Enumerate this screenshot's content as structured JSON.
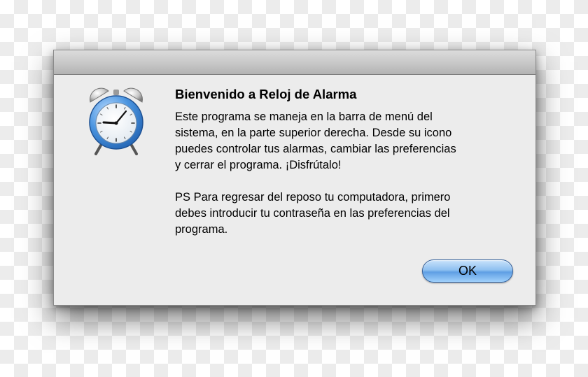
{
  "dialog": {
    "title": "Bienvenido a Reloj de Alarma",
    "message": "Este programa se maneja en la barra de menú del\nsistema, en la parte superior derecha. Desde su icono\npuedes controlar tus alarmas, cambiar las preferencias\ny cerrar el programa. ¡Disfrútalo!",
    "ps_note": "PS Para regresar del reposo tu computadora, primero\ndebes introducir tu contraseña en las preferencias del\nprograma.",
    "ok_label": "OK",
    "icon": "alarm-clock-icon"
  },
  "colors": {
    "window_bg": "#ececec",
    "button_blue": "#8fc0f0",
    "clock_blue": "#3f8ede"
  }
}
